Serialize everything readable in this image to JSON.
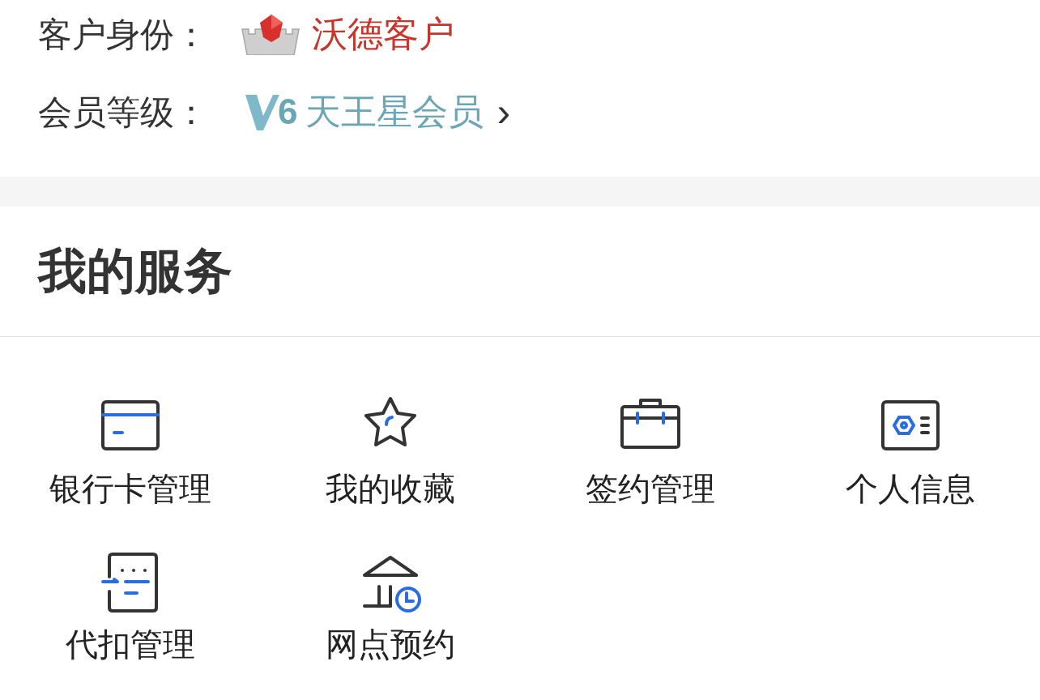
{
  "profile": [
    {
      "kind": "identity",
      "label": "客户身份：",
      "value": "沃德客户"
    },
    {
      "kind": "level",
      "label": "会员等级：",
      "badge_number": "6",
      "value": "天王星会员",
      "chevron": "›"
    }
  ],
  "services": {
    "title": "我的服务",
    "items": [
      {
        "label": "银行卡管理"
      },
      {
        "label": "我的收藏"
      },
      {
        "label": "签约管理"
      },
      {
        "label": "个人信息"
      },
      {
        "label": "代扣管理"
      },
      {
        "label": "网点预约"
      }
    ]
  }
}
